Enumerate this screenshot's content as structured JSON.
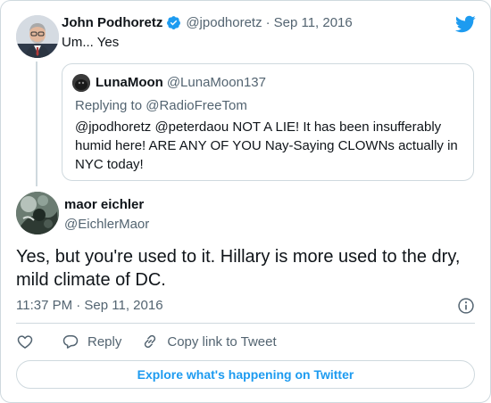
{
  "parent": {
    "name": "John Podhoretz",
    "handle": "@jpodhoretz",
    "separator": "·",
    "date": "Sep 11, 2016",
    "text": "Um... Yes",
    "avatar_icon": "user-photo-icon",
    "verified_icon": "verified-badge-icon"
  },
  "quote": {
    "name": "LunaMoon",
    "handle": "@LunaMoon137",
    "replying_prefix": "Replying to ",
    "replying_to": "@RadioFreeTom",
    "text": "@jpodhoretz @peterdaou NOT A LIE! It has been insufferably humid here! ARE ANY OF YOU Nay-Saying CLOWNs actually in NYC today!"
  },
  "tweet": {
    "name": "maor eichler",
    "handle": "@EichlerMaor",
    "text": "Yes, but you're used to it.  Hillary is more used to the dry, mild climate of DC.",
    "time": "11:37 PM · Sep 11, 2016"
  },
  "actions": {
    "reply_label": "Reply",
    "copy_label": "Copy link to Tweet"
  },
  "footer": {
    "explore_label": "Explore what's happening on Twitter"
  },
  "colors": {
    "brand": "#1d9bf0",
    "text": "#0f1419",
    "secondary": "#536471",
    "border": "#cfd9de"
  }
}
